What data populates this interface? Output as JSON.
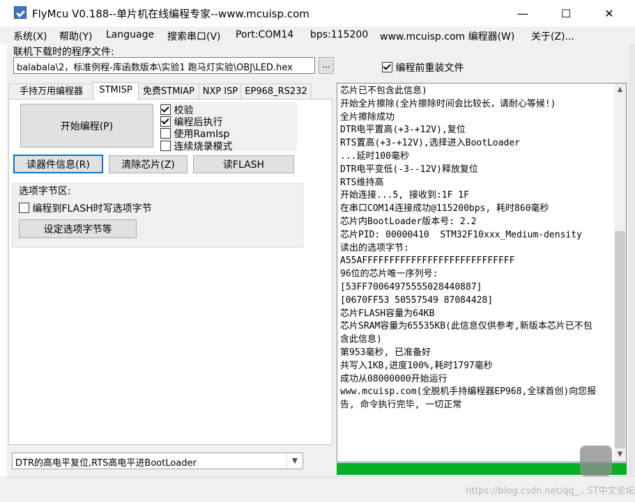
{
  "window": {
    "title": "FlyMcu V0.188--单片机在线编程专家--www.mcuisp.com",
    "minimize_glyph": "—",
    "maximize_glyph": "☐",
    "close_glyph": "✕"
  },
  "menu": [
    "系统(X)",
    "帮助(Y)",
    "Language",
    "搜索串口(V)",
    "Port:COM14",
    "bps:115200",
    "www.mcuisp.com 编程器(W)",
    "关于(Z)..."
  ],
  "file": {
    "label": "联机下载时的程序文件:",
    "path": "balabala\\2，标准例程-库函数版本\\实验1 跑马灯实验\\OBJ\\LED.hex",
    "browse_label": "...",
    "reload_label": "编程前重装文件",
    "reload_checked": true
  },
  "tabs": [
    "手持万用编程器",
    "STMISP",
    "免费STMIAP",
    "NXP ISP",
    "EP968_RS232"
  ],
  "panel": {
    "start_button": "开始编程(P)",
    "options": [
      {
        "label": "校验",
        "checked": true
      },
      {
        "label": "编程后执行",
        "checked": true
      },
      {
        "label": "使用RamIsp",
        "checked": false
      },
      {
        "label": "连续烧录模式",
        "checked": false
      }
    ],
    "read_info_button": "读器件信息(R)",
    "erase_button": "清除芯片(Z)",
    "read_flash_button": "读FLASH",
    "option_group": {
      "title": "选项字节区:",
      "write_option_label": "编程到FLASH时写选项字节",
      "write_option_checked": false,
      "set_button": "设定选项字节等"
    },
    "reset_mode": "DTR的高电平复位,RTS高电平进BootLoader"
  },
  "log": [
    "芯片已不包含此信息)",
    "开始全片擦除(全片擦除时间会比较长，请耐心等候!)",
    "全片擦除成功",
    "DTR电平置高(+3-+12V),复位",
    "RTS置高(+3-+12V),选择进入BootLoader",
    "...延时100毫秒",
    "DTR电平变低(-3--12V)释放复位",
    "RTS维持高",
    "开始连接...5, 接收到:1F 1F",
    "在串口COM14连接成功@115200bps, 耗时860毫秒",
    "芯片内BootLoader版本号: 2.2",
    "芯片PID: 00000410  STM32F10xxx_Medium-density",
    "读出的选项字节:",
    "A55AFFFFFFFFFFFFFFFFFFFFFFFFFFFF",
    "96位的芯片唯一序列号:",
    "[53FF70064975555028440887]",
    "[0670FF53 50557549 87084428]",
    "芯片FLASH容量为64KB",
    "芯片SRAM容量为65535KB(此信息仅供参考,新版本芯片已不包含此信息)",
    "第953毫秒, 已准备好",
    "共写入1KB,进度100%,耗时1797毫秒",
    "成功从08000000开始运行",
    "www.mcuisp.com(全脱机手持编程器EP968,全球首创)向您报告, 命令执行完毕, 一切正常"
  ],
  "progress_percent": 100,
  "watermark": "https://blog.csdn.net/qq_...ST中文论坛"
}
